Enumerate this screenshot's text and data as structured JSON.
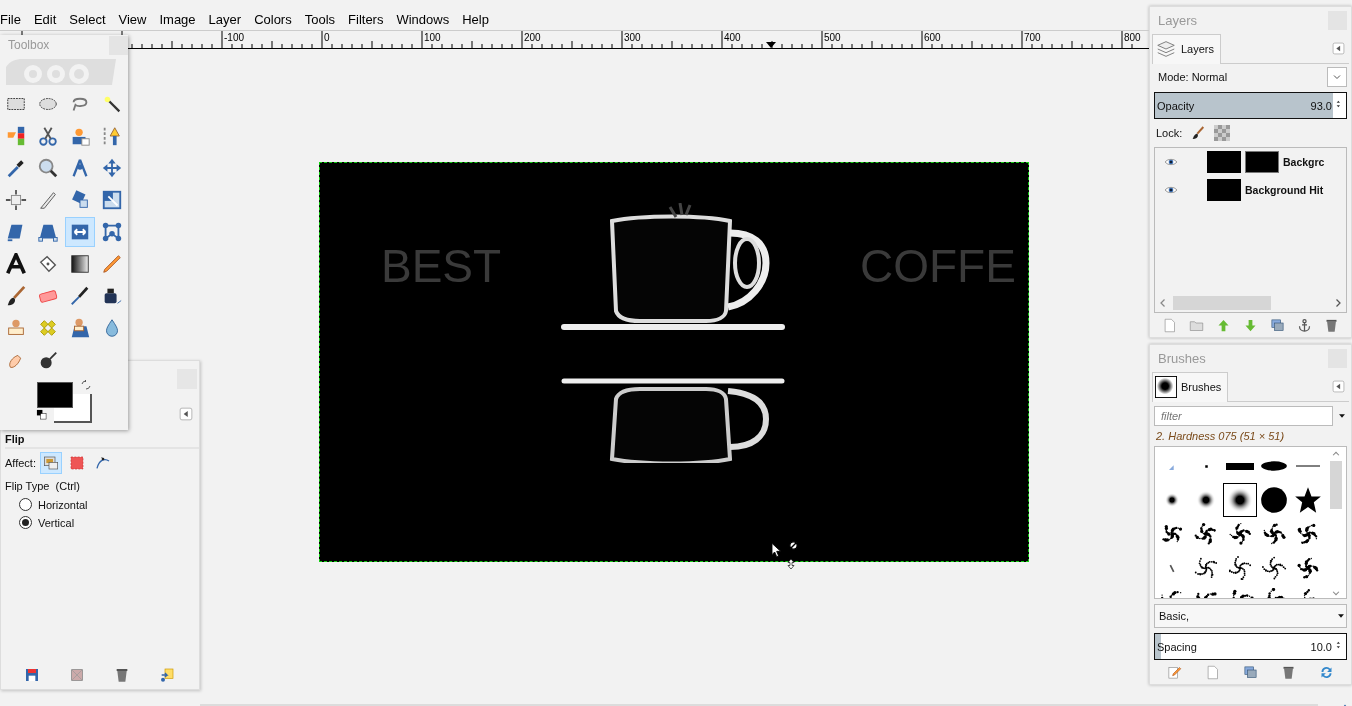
{
  "menu": [
    "File",
    "Edit",
    "Select",
    "View",
    "Image",
    "Layer",
    "Colors",
    "Tools",
    "Filters",
    "Windows",
    "Help"
  ],
  "ruler": {
    "labels": [
      "-100",
      "0",
      "100",
      "200",
      "300",
      "400",
      "500",
      "600",
      "700",
      "800"
    ]
  },
  "canvas": {
    "texts": [
      "BEST",
      "COFFE"
    ]
  },
  "toolbox": {
    "title": "Toolbox",
    "tools": [
      {
        "selected": false
      },
      {
        "selected": false
      },
      {
        "selected": false
      },
      {
        "selected": false
      },
      {
        "selected": false
      },
      {
        "selected": false
      },
      {
        "selected": false
      },
      {
        "selected": false
      },
      {
        "selected": false
      },
      {
        "selected": false
      },
      {
        "selected": false
      },
      {
        "selected": false
      },
      {
        "selected": false
      },
      {
        "selected": false
      },
      {
        "selected": false
      },
      {
        "selected": false
      },
      {
        "selected": false
      },
      {
        "selected": false
      },
      {
        "selected": true
      },
      {
        "selected": false
      },
      {
        "selected": false
      },
      {
        "selected": false
      },
      {
        "selected": false
      },
      {
        "selected": false
      },
      {
        "selected": false
      },
      {
        "selected": false
      },
      {
        "selected": false
      },
      {
        "selected": false
      },
      {
        "selected": false
      },
      {
        "selected": false
      },
      {
        "selected": false
      },
      {
        "selected": false
      },
      {
        "selected": false
      },
      {
        "selected": false
      }
    ]
  },
  "tool_options": {
    "title": "Flip",
    "affect_label": "Affect:",
    "affect": [
      {
        "selected": true
      },
      {
        "selected": false
      },
      {
        "selected": false
      }
    ],
    "flip_type_label": "Flip Type  (Ctrl)",
    "flip_types": [
      {
        "label": "Horizontal",
        "selected": false
      },
      {
        "label": "Vertical",
        "selected": true
      }
    ]
  },
  "layers": {
    "title": "Layers",
    "tab": "Layers",
    "mode": "Mode: Normal",
    "opacity": {
      "label": "Opacity",
      "value": "93.0",
      "level": 0.93
    },
    "lock_label": "Lock:",
    "items": [
      {
        "name": "Backgrc",
        "visible": true,
        "has_mask": true,
        "selected": false
      },
      {
        "name": "Background Hit",
        "visible": true,
        "has_mask": false,
        "selected": false
      }
    ]
  },
  "brushes": {
    "title": "Brushes",
    "tab": "Brushes",
    "filter": {
      "placeholder": "filter"
    },
    "current": "2. Hardness 075 (51 × 51)",
    "items": [
      {
        "selected": false
      },
      {
        "selected": false
      },
      {
        "selected": false
      },
      {
        "selected": false
      },
      {
        "selected": false
      },
      {
        "selected": false
      },
      {
        "selected": false
      },
      {
        "selected": true
      },
      {
        "selected": false
      },
      {
        "selected": false
      },
      {
        "selected": false
      },
      {
        "selected": false
      },
      {
        "selected": false
      },
      {
        "selected": false
      },
      {
        "selected": false
      },
      {
        "selected": false
      },
      {
        "selected": false
      },
      {
        "selected": false
      },
      {
        "selected": false
      },
      {
        "selected": false
      },
      {
        "selected": false
      },
      {
        "selected": false
      },
      {
        "selected": false
      },
      {
        "selected": false
      },
      {
        "selected": false
      }
    ],
    "set": "Basic,",
    "spacing": {
      "label": "Spacing",
      "value": "10.0",
      "level": 0.03
    }
  }
}
